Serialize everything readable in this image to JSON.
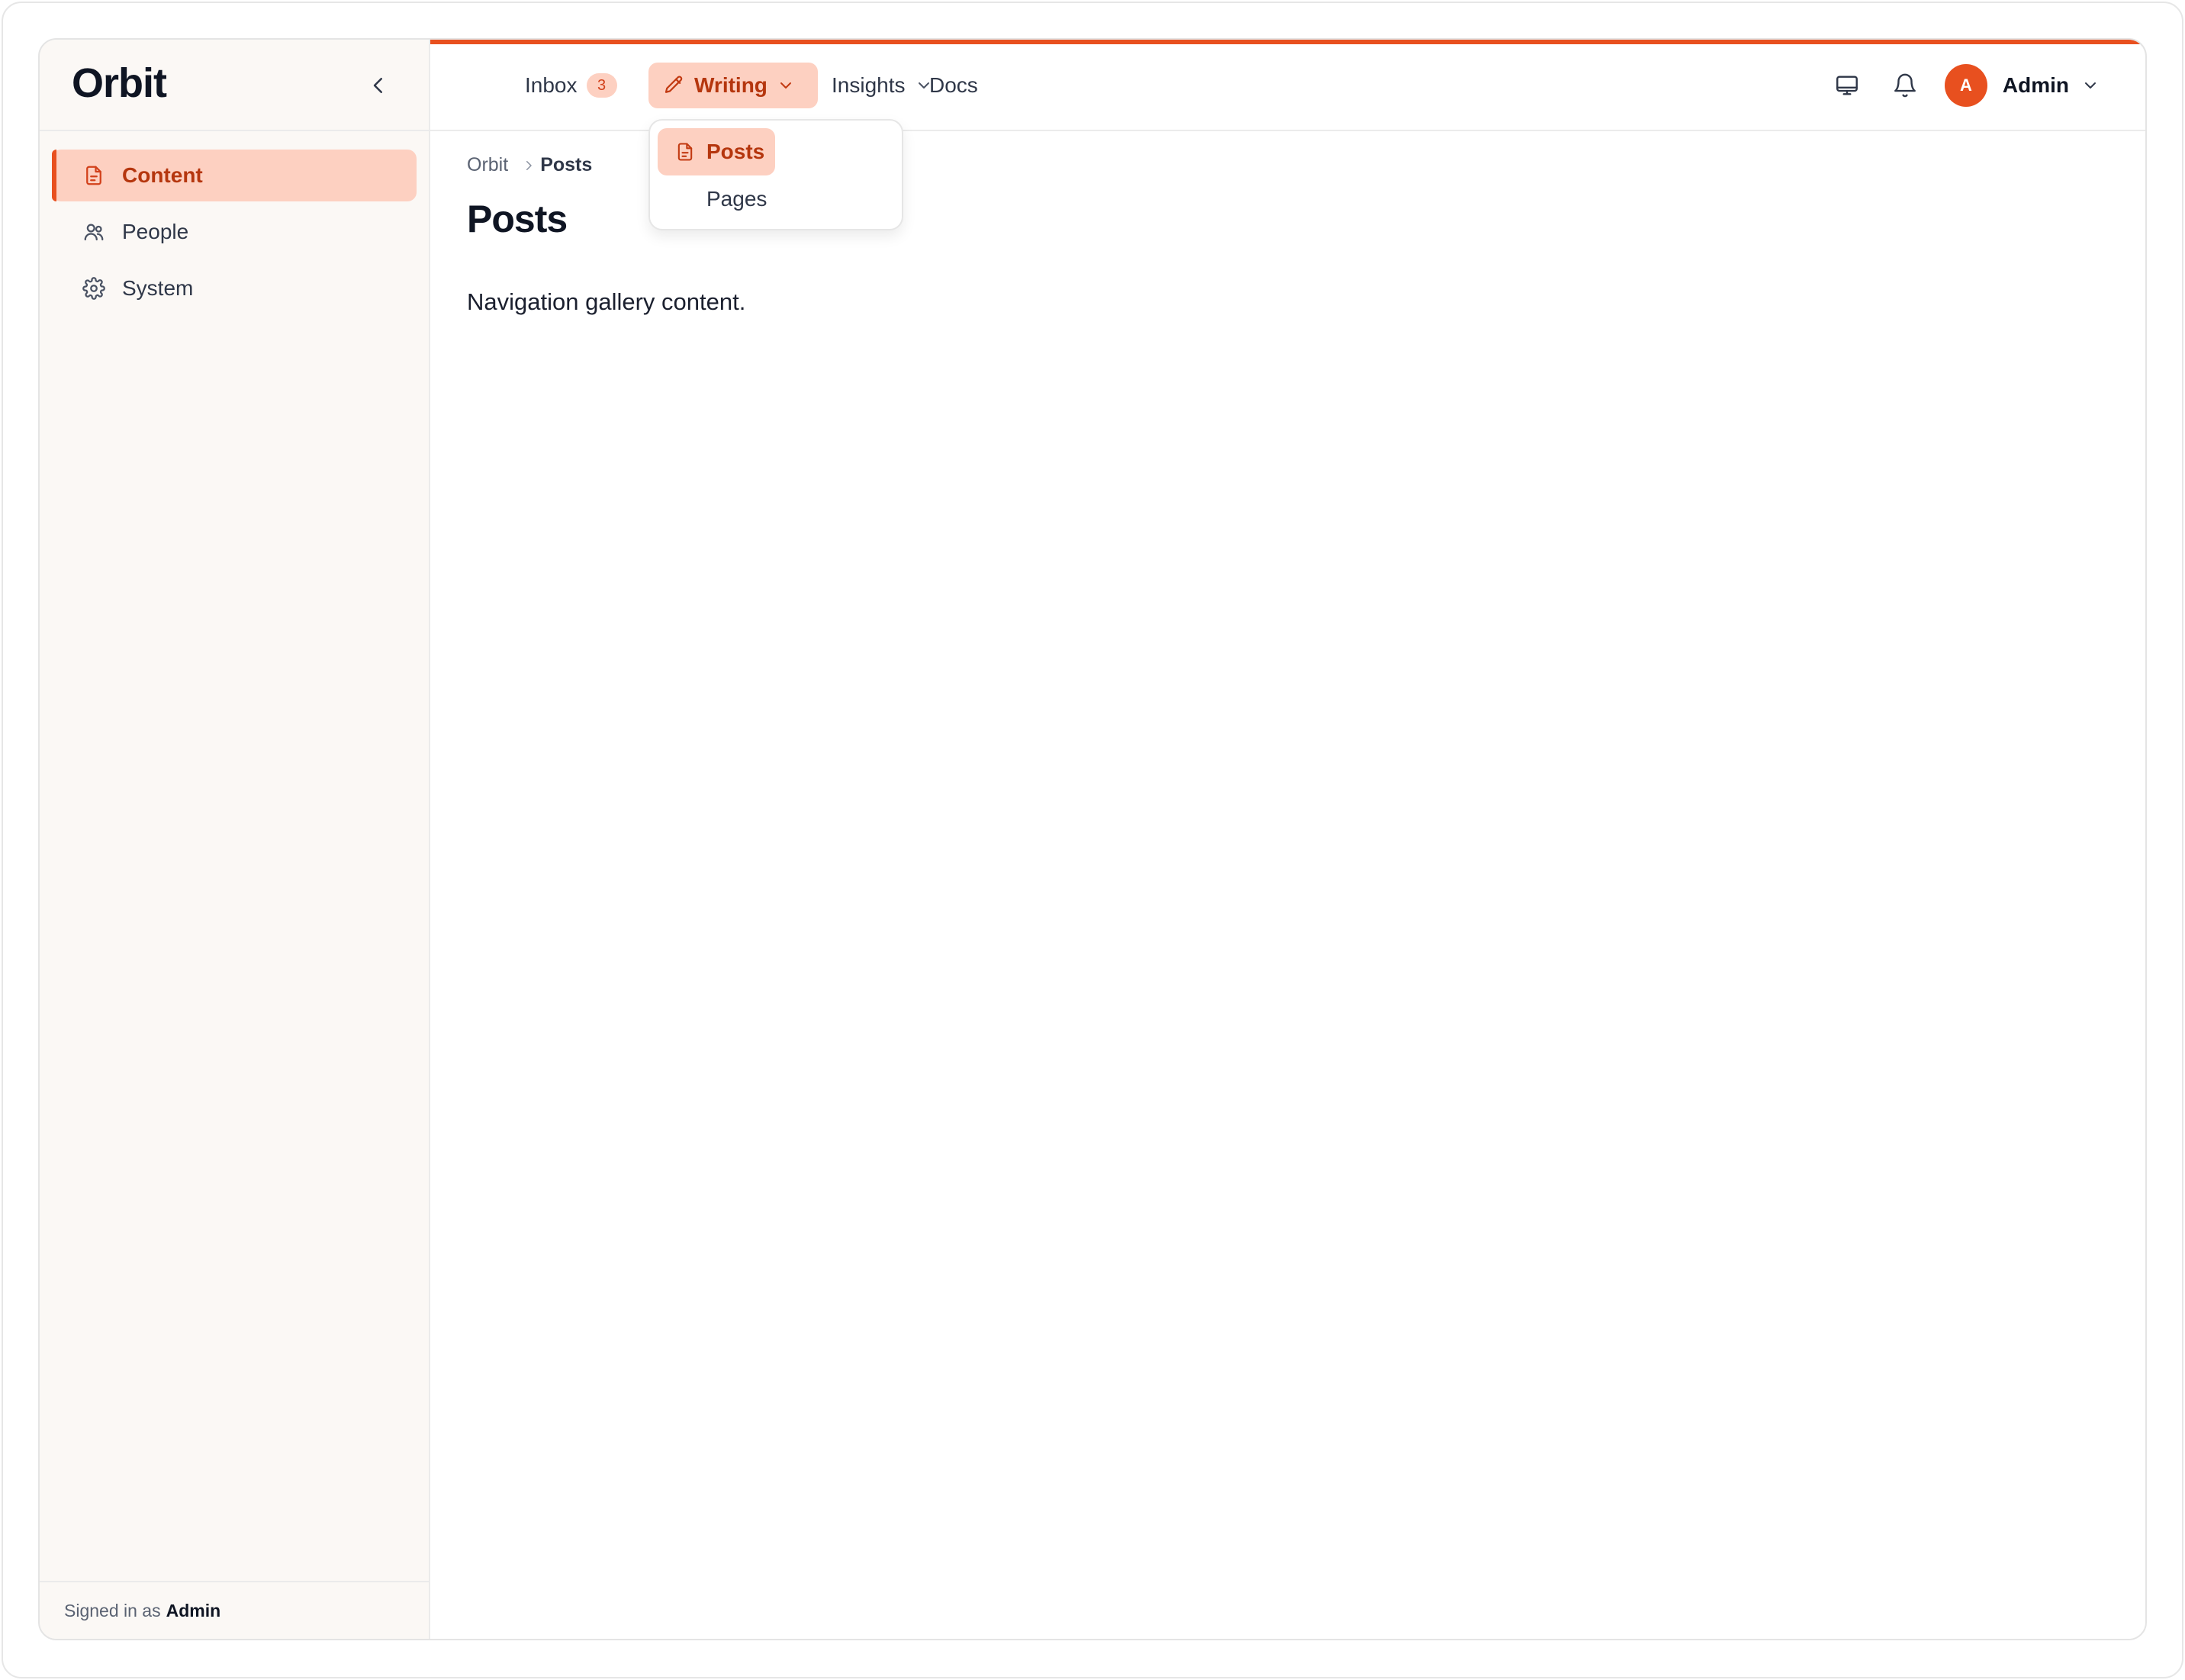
{
  "app": {
    "brand": "Orbit",
    "accent_color": "#e8501f",
    "accent_soft_color": "#fdd0c1"
  },
  "sidebar": {
    "collapse_icon": "chevron-left-icon",
    "items": [
      {
        "label": "Content",
        "icon": "document-icon",
        "active": true
      },
      {
        "label": "People",
        "icon": "users-icon",
        "active": false
      },
      {
        "label": "System",
        "icon": "gear-icon",
        "active": false
      }
    ],
    "footer": {
      "prefix": "Signed in as",
      "user": "Admin"
    }
  },
  "topnav": {
    "inbox": {
      "label": "Inbox",
      "badge": "3"
    },
    "writing": {
      "label": "Writing",
      "icon": "pencil-icon"
    },
    "insights": {
      "label": "Insights"
    },
    "docs": {
      "label": "Docs"
    },
    "writing_menu": [
      {
        "label": "Posts",
        "icon": "document-icon",
        "active": true
      },
      {
        "label": "Pages",
        "active": false
      }
    ]
  },
  "user": {
    "avatar_letter": "A",
    "name": "Admin"
  },
  "main": {
    "breadcrumb": [
      "Orbit",
      "Posts"
    ],
    "title": "Posts",
    "body": "Navigation gallery content."
  }
}
